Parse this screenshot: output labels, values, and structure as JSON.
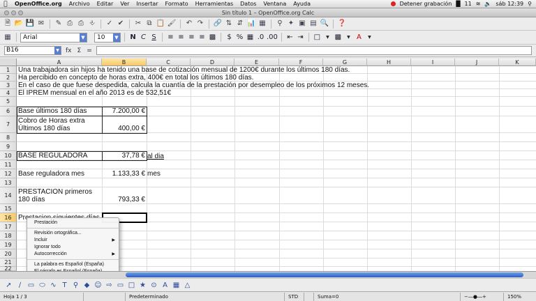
{
  "menubar": {
    "app": "OpenOffice.org",
    "items": [
      "Archivo",
      "Editar",
      "Ver",
      "Insertar",
      "Formato",
      "Herramientas",
      "Datos",
      "Ventana",
      "Ayuda"
    ],
    "record": "Detener grabación",
    "battery": "11",
    "clock": "sáb 12:39"
  },
  "window": {
    "title": "Sin título 1 – OpenOffice.org Calc"
  },
  "format": {
    "font": "Arial",
    "size": "10",
    "bold": "N",
    "italic": "C",
    "underline": "S"
  },
  "formula": {
    "cell_ref": "B16",
    "fx": "fx",
    "sigma": "Σ",
    "equals": "="
  },
  "columns": [
    "A",
    "B",
    "C",
    "D",
    "E",
    "F",
    "G",
    "H",
    "I",
    "J",
    "K"
  ],
  "rows": [
    "1",
    "2",
    "3",
    "4",
    "5",
    "6",
    "7",
    "8",
    "9",
    "10",
    "11",
    "12",
    "13",
    "14",
    "15",
    "16",
    "17",
    "18",
    "19",
    "20",
    "21",
    "22"
  ],
  "cells": {
    "r1": "Una trabajadora sin hijos ha tenido una base de cotización mensual de 1200€ durante los últimos 180 días.",
    "r2": "Ha percibido en concepto de horas extra, 400€ en total los últimos 180 días.",
    "r3": "En el caso de que fuese despedida, calcula la cuantía de la prestación por desempleo de los próximos 12 meses.",
    "r4": "El IPREM mensual en el año 2013 es de 532,51€",
    "a6": "Base últimos 180 días",
    "b6": "7.200,00 €",
    "a7_1": "Cobro de Horas extra",
    "a7_2": "Últimos 180 días",
    "b7": "400,00 €",
    "a10": "BASE REGULADORA",
    "b10": "37,78 €",
    "c10": "al dia",
    "a12": "Base reguladora mes",
    "b12": "1.133,33 €",
    "c12": "mes",
    "a14_1": "PRESTACION primeros",
    "a14_2": "180 días",
    "b14": "793,33 €",
    "a16": "Prestacion siguientes días"
  },
  "context_menu": {
    "items": [
      "Prestación",
      "Revisión ortográfica...",
      "Incluir",
      "Ignorar todo",
      "Autocorrección",
      "La palabra es Español (España)",
      "El párrafo es Español (España)"
    ]
  },
  "status": {
    "sheet": "Hoja 1 / 3",
    "style": "Predeterminado",
    "mode": "STD",
    "sum": "Suma=0",
    "zoom": "150%"
  }
}
